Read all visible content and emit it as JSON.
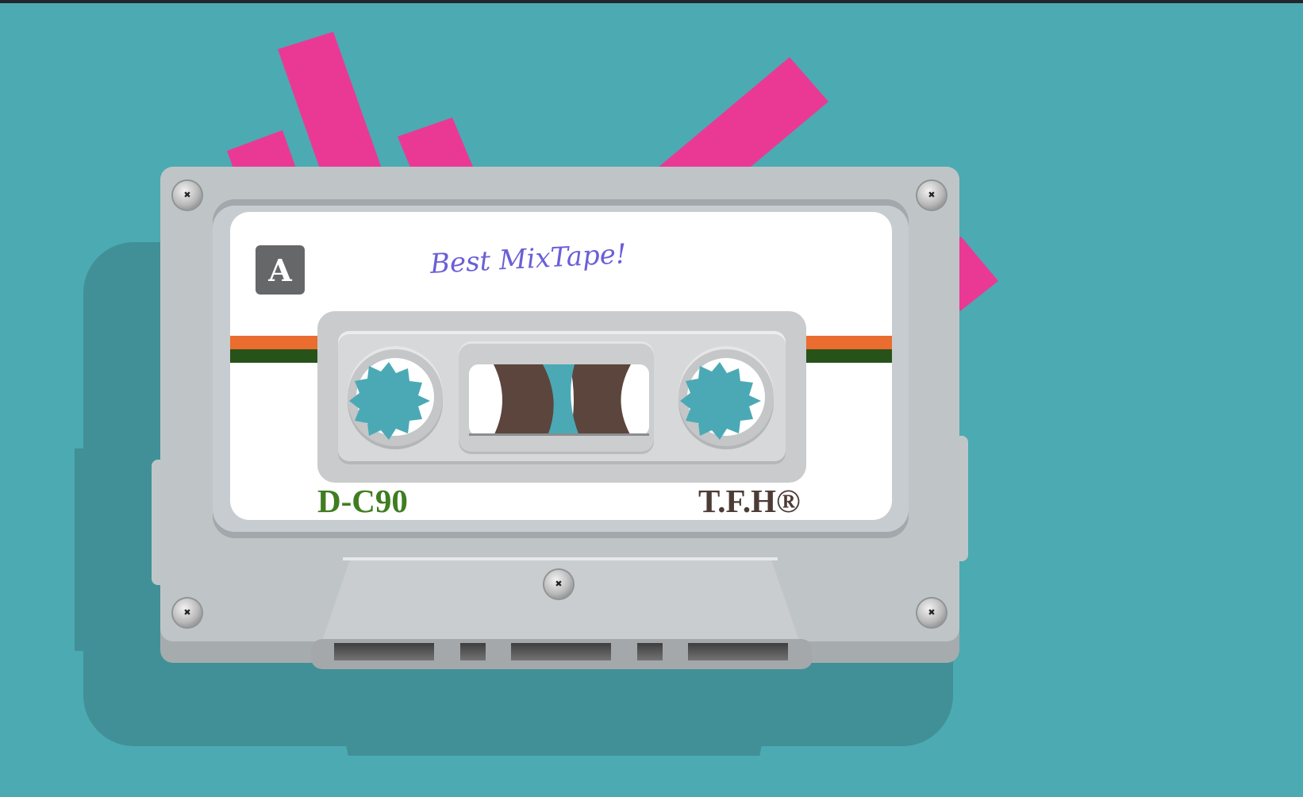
{
  "cassette": {
    "side": "A",
    "title": "Best MixTape!",
    "model": "D-C90",
    "brand": "T.F.H®"
  },
  "colors": {
    "background": "#4caab2",
    "accent_bars": "#ea3994",
    "stripe_orange": "#ea6c2e",
    "stripe_green": "#27531a",
    "reel_hub": "#4ba9b5",
    "tape": "#5c453d",
    "model_text": "#3f7d21",
    "brand_text": "#4d3b35",
    "title_text": "#6a5fd8"
  },
  "icons": {
    "screw": "screw-icon",
    "reel_gear": "reel-gear-icon"
  }
}
